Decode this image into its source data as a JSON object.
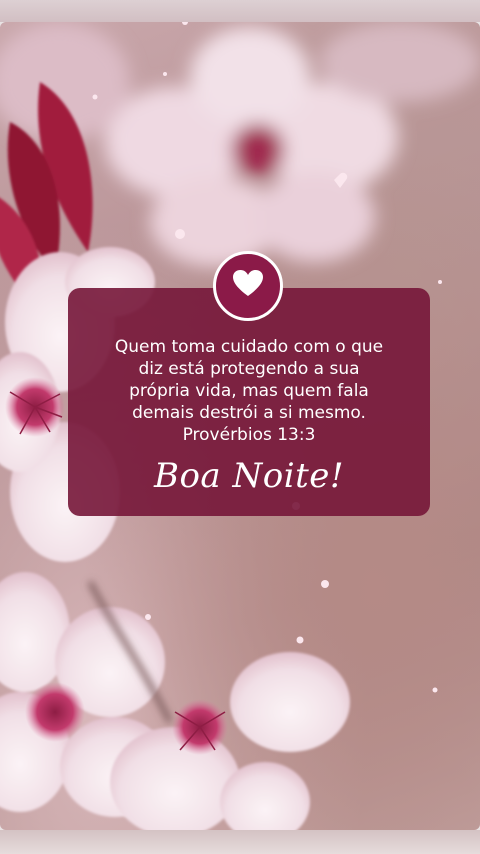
{
  "card": {
    "quote": "Quem toma cuidado com o que\ndiz está protegendo a sua\nprópria vida, mas quem fala\ndemais destrói a si mesmo.",
    "reference": "Provérbios 13:3",
    "greeting": "Boa Noite!"
  },
  "badge": {
    "icon": "heart-icon"
  },
  "colors": {
    "card_background": "#761638",
    "text": "#ffffff",
    "petal": "#f3e6ea",
    "blossom_center": "#b4245a"
  }
}
